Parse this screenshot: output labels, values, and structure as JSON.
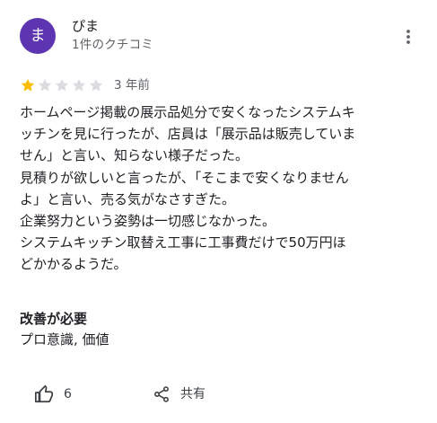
{
  "colors": {
    "avatar_bg": "#5e35b1",
    "star_filled": "#fbbc04",
    "star_empty": "#dadce0",
    "secondary_text": "#5f6368"
  },
  "review": {
    "avatar_initial": "ま",
    "author_name": "ぴま",
    "author_meta": "1件のクチコミ",
    "rating": 1,
    "rating_max": 5,
    "date": "3 年前",
    "text_lines": [
      "ホームページ掲載の展示品処分で安くなったシステムキ",
      "ッチンを見に行ったが、店員は「展示品は販売していま",
      "せん」と言い、知らない様子だった。",
      "見積りが欲しいと言ったが、「そこまで安くなりません",
      "よ」と言い、売る気がなさすぎた。",
      "企業努力という姿勢は一切感じなかった。",
      "システムキッチン取替え工事に工事費だけで50万円ほ",
      "どかかるようだ。"
    ],
    "improvement_title": "改善が必要",
    "improvement_value": "プロ意識, 価値"
  },
  "actions": {
    "like_count": "6",
    "like_icon": "thumbs-up-icon",
    "share_label": "共有",
    "share_icon": "share-icon",
    "more_icon": "more-vert-icon"
  }
}
